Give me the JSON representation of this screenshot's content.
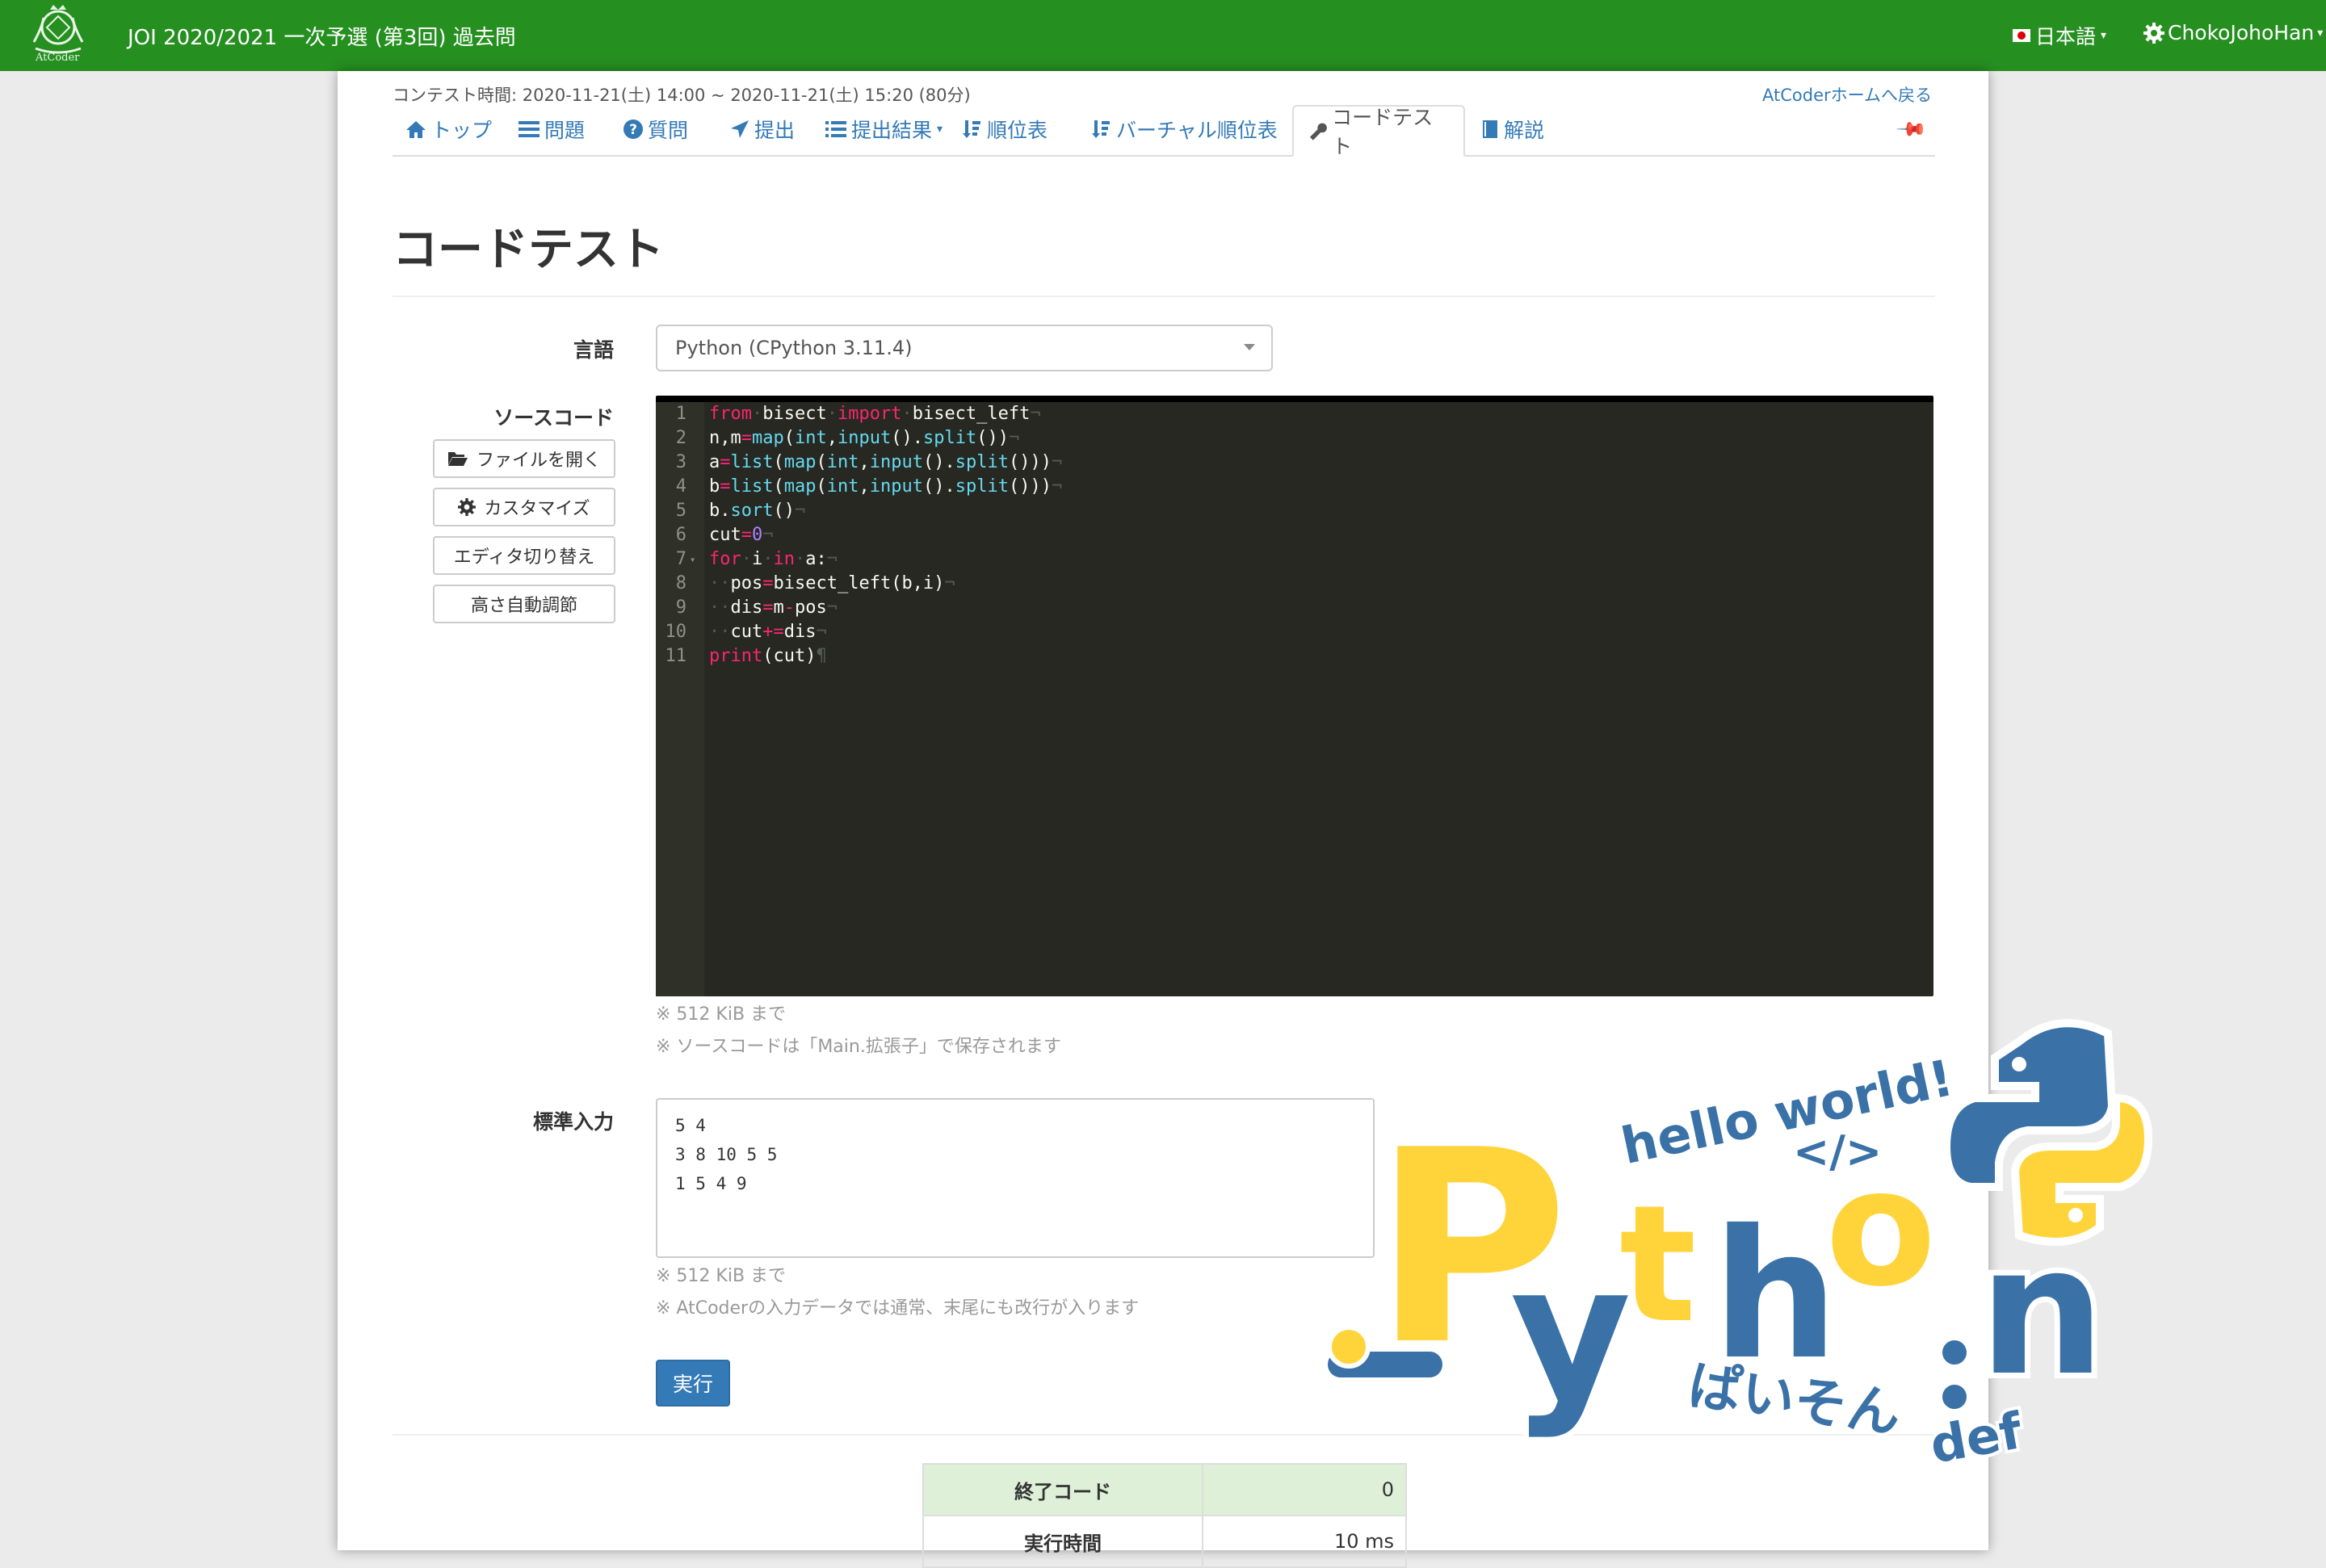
{
  "header": {
    "logo_text": "AtCoder",
    "contest_title": "JOI 2020/2021 一次予選 (第3回) 過去問",
    "language": "日本語",
    "username": "ChokoJohoHan"
  },
  "contest": {
    "time": "コンテスト時間: 2020-11-21(土) 14:00 ~ 2020-11-21(土) 15:20 (80分)",
    "back_home": "AtCoderホームへ戻る"
  },
  "tabs": [
    {
      "label": "トップ",
      "icon": "home-icon"
    },
    {
      "label": "問題",
      "icon": "list-icon"
    },
    {
      "label": "質問",
      "icon": "question-icon"
    },
    {
      "label": "提出",
      "icon": "send-icon"
    },
    {
      "label": "提出結果",
      "icon": "list-icon"
    },
    {
      "label": "順位表",
      "icon": "sort-icon"
    },
    {
      "label": "バーチャル順位表",
      "icon": "sort-icon"
    },
    {
      "label": "コードテスト",
      "icon": "wrench-icon"
    },
    {
      "label": "解説",
      "icon": "book-icon"
    }
  ],
  "page_title": "コードテスト",
  "form": {
    "language_label": "言語",
    "language_value": "Python (CPython 3.11.4)",
    "source_label": "ソースコード",
    "open_file": "ファイルを開く",
    "customize": "カスタマイズ",
    "switch_editor": "エディタ切り替え",
    "auto_height": "高さ自動調節",
    "source_limit": "※ 512 KiB まで",
    "source_saved": "※ ソースコードは「Main.拡張子」で保存されます",
    "stdin_label": "標準入力",
    "stdin_value": "5 4\n3 8 10 5 5\n1 5 4 9",
    "stdin_limit": "※ 512 KiB まで",
    "stdin_note": "※ AtCoderの入力データでは通常、末尾にも改行が入ります",
    "run_button": "実行"
  },
  "code": [
    "from bisect import bisect_left",
    "n,m=map(int,input().split())",
    "a=list(map(int,input().split()))",
    "b=list(map(int,input().split()))",
    "b.sort()",
    "cut=0",
    "for i in a:",
    "  pos=bisect_left(b,i)",
    "  dis=m-pos",
    "  cut+=dis",
    "print(cut)"
  ],
  "results": [
    {
      "key": "終了コード",
      "value": "0"
    },
    {
      "key": "実行時間",
      "value": "10 ms"
    }
  ],
  "sticker": {
    "hello": "hello world!",
    "tag": "</>",
    "big": "Python",
    "kana": "ぱいそん",
    "def": "def"
  }
}
